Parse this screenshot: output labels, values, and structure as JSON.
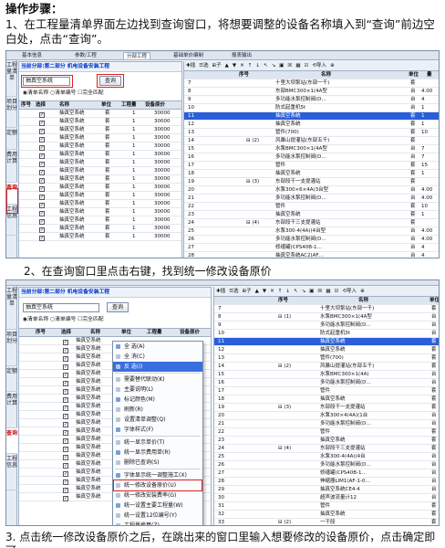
{
  "heading": "操作步骤：",
  "step1": "1、在工程量清单界面左边找到查询窗口，将想要调整的设备名称填入到“查询”前边空白处，点击“查询”。",
  "step2": "2、在查询窗口里点击右键，找到统一修改设备原价",
  "step3": "3. 点击统一修改设备原价之后，在跳出来的窗口里输入想要修改的设备原价，点击确定即可。",
  "tabs": [
    "基本信息",
    "参数/工程",
    "分部工程",
    "基础单价编制",
    "报表输出"
  ],
  "side_tabs": [
    "工程量清单",
    "项目划分",
    "定额",
    "费用计算",
    "查询",
    "工程信息"
  ],
  "side_tabs2": [
    "工程量清单",
    "项目划分",
    "定额",
    "费用计算",
    "查询",
    "工程信息"
  ],
  "panel_title": "当前分部:第二部分 机电设备安装工程",
  "search_value": "抽真空系统",
  "search_button": "查询",
  "radio_list": "◉清单名称",
  "radio_code": "○清单编号",
  "radio_full": "☐完全匹配",
  "left_cols": [
    "序号",
    "选择",
    "名称",
    "单位",
    "工程量",
    "设备原价"
  ],
  "left_cols2": [
    "序号",
    "选择",
    "名称",
    "单位",
    "工程量",
    "设备原价"
  ],
  "left_rows": [
    {
      "name": "抽真空系统",
      "unit": "套",
      "qty": "1",
      "price": "30000"
    },
    {
      "name": "抽真空系统",
      "unit": "套",
      "qty": "1",
      "price": "30000"
    },
    {
      "name": "抽真空系统",
      "unit": "套",
      "qty": "1",
      "price": "30000"
    },
    {
      "name": "抽真空系统",
      "unit": "套",
      "qty": "1",
      "price": "30000"
    },
    {
      "name": "抽真空系统",
      "unit": "套",
      "qty": "1",
      "price": "30000"
    },
    {
      "name": "抽真空系统",
      "unit": "套",
      "qty": "1",
      "price": "30000"
    },
    {
      "name": "抽真空系统",
      "unit": "套",
      "qty": "1",
      "price": "30000"
    },
    {
      "name": "抽真空系统",
      "unit": "套",
      "qty": "1",
      "price": "30000"
    },
    {
      "name": "抽真空系统",
      "unit": "套",
      "qty": "1",
      "price": "30000"
    },
    {
      "name": "抽真空系统",
      "unit": "套",
      "qty": "1",
      "price": "30000"
    },
    {
      "name": "抽真空系统",
      "unit": "套",
      "qty": "1",
      "price": "30000"
    },
    {
      "name": "抽真空系统",
      "unit": "套",
      "qty": "1",
      "price": "30000"
    },
    {
      "name": "抽真空系统",
      "unit": "套",
      "qty": "1",
      "price": "30000"
    },
    {
      "name": "抽真空系统",
      "unit": "套",
      "qty": "1",
      "price": "30000"
    },
    {
      "name": "抽真空系统",
      "unit": "套",
      "qty": "1",
      "price": "30000"
    },
    {
      "name": "抽真空系统",
      "unit": "套",
      "qty": "1",
      "price": "30000"
    }
  ],
  "left_rows2": [
    "抽真空系统",
    "抽真空系统",
    "抽真空系统",
    "抽真空系统",
    "抽真空系统",
    "抽真空系统",
    "抽真空系统",
    "抽真空系统",
    "抽真空系统",
    "抽真空系统",
    "抽真空系统",
    "抽真空系统",
    "抽真空系统",
    "抽真空系统",
    "抽真空系统",
    "抽真空系统",
    "抽真空系统",
    "抽真空系统",
    "抽真空系统",
    "抽真空系统"
  ],
  "toolbar_items": [
    "✚插",
    "☰选",
    "⊞子",
    "▲",
    "▼",
    "✕",
    "↑",
    "↓",
    "↖",
    "↘",
    "▣",
    "☒",
    "▦",
    "☑",
    "⟲导入",
    "⊕"
  ],
  "right_cols": [
    "序号",
    "名称",
    "单位",
    "量"
  ],
  "right_rows": [
    {
      "no": "7",
      "mark": "",
      "name": "十里大坝泵站(东部一千)",
      "unit": "套"
    },
    {
      "no": "8",
      "mark": "",
      "name": "东部BMC300×1(4A型",
      "unit": "台",
      "qty": "4.00"
    },
    {
      "no": "9",
      "mark": "",
      "name": "多功能水泵控制阀(D…",
      "unit": "台",
      "qty": "4"
    },
    {
      "no": "10",
      "mark": "",
      "name": "防式起重机5t",
      "unit": "台",
      "qty": "1"
    },
    {
      "no": "11",
      "mark": "",
      "name": "抽真空系统",
      "unit": "套",
      "qty": "1",
      "hl": true
    },
    {
      "no": "12",
      "mark": "",
      "name": "抽真空系统",
      "unit": "套",
      "qty": "1"
    },
    {
      "no": "13",
      "mark": "",
      "name": "管件(700)",
      "unit": "套",
      "qty": "10"
    },
    {
      "no": "14",
      "mark": "⊟ (2)",
      "name": "风暴山提灌站(东部五千)",
      "unit": "套"
    },
    {
      "no": "15",
      "mark": "",
      "name": "水泵BMC300×1(4A型",
      "unit": "台",
      "qty": "7"
    },
    {
      "no": "16",
      "mark": "",
      "name": "多功能水泵控制阀(D…",
      "unit": "台",
      "qty": "7"
    },
    {
      "no": "17",
      "mark": "",
      "name": "管件",
      "unit": "套",
      "qty": "15"
    },
    {
      "no": "18",
      "mark": "",
      "name": "抽真空系统",
      "unit": "套",
      "qty": "1"
    },
    {
      "no": "19",
      "mark": "⊟ (3)",
      "name": "东部段干一支提灌站",
      "unit": "套"
    },
    {
      "no": "20",
      "mark": "",
      "name": "水泵300×6×4A(3台型",
      "unit": "台",
      "qty": "4.00"
    },
    {
      "no": "21",
      "mark": "",
      "name": "多功能水泵控制阀(D…",
      "unit": "台",
      "qty": "4.00"
    },
    {
      "no": "22",
      "mark": "",
      "name": "管件",
      "unit": "套",
      "qty": "10"
    },
    {
      "no": "23",
      "mark": "",
      "name": "抽真空系统",
      "unit": "套",
      "qty": "1"
    },
    {
      "no": "24",
      "mark": "⊟ (4)",
      "name": "东部段干三支提灌站",
      "unit": "套"
    },
    {
      "no": "25",
      "mark": "",
      "name": "水泵300-4(4A)(4台型",
      "unit": "台",
      "qty": "4.00"
    },
    {
      "no": "26",
      "mark": "",
      "name": "多功能水泵控制阀(D…",
      "unit": "台",
      "qty": "4.00"
    },
    {
      "no": "27",
      "mark": "",
      "name": "修缮罐(CPS40B-1…",
      "unit": "台",
      "qty": "4"
    },
    {
      "no": "28",
      "mark": "",
      "name": "抽真空系统AC2(AF…",
      "unit": "台",
      "qty": "4"
    },
    {
      "no": "29",
      "mark": "",
      "name": "抽真空系统CE4-4",
      "unit": "台",
      "qty": "4"
    },
    {
      "no": "30",
      "mark": "",
      "name": "超声波流量计12",
      "unit": "台",
      "qty": "4"
    },
    {
      "no": "31",
      "mark": "",
      "name": "抽真空系统",
      "unit": "台",
      "qty": "4"
    }
  ],
  "right_rows2": [
    {
      "no": "7",
      "mark": "",
      "name": "十里大坝泵站(东部一千)",
      "unit": "套"
    },
    {
      "no": "8",
      "mark": "⊟ (1)",
      "name": "水泵BMC300×1(4A型",
      "unit": "台"
    },
    {
      "no": "9",
      "mark": "",
      "name": "多功能水泵控制阀(D…",
      "unit": "台"
    },
    {
      "no": "10",
      "mark": "",
      "name": "防式起重机5t",
      "unit": "台"
    },
    {
      "no": "11",
      "mark": "",
      "name": "抽真空系统",
      "unit": "套",
      "hl": true
    },
    {
      "no": "12",
      "mark": "",
      "name": "抽真空系统",
      "unit": "套"
    },
    {
      "no": "13",
      "mark": "",
      "name": "管件(700)",
      "unit": "套"
    },
    {
      "no": "14",
      "mark": "⊟ (2)",
      "name": "风暴山提灌站(东部五千)",
      "unit": "套"
    },
    {
      "no": "15",
      "mark": "",
      "name": "水泵BMC300×1(4A)",
      "unit": "台"
    },
    {
      "no": "16",
      "mark": "",
      "name": "多功能水泵控制阀(D…",
      "unit": "台"
    },
    {
      "no": "17",
      "mark": "",
      "name": "管件",
      "unit": "套"
    },
    {
      "no": "18",
      "mark": "",
      "name": "抽真空系统",
      "unit": "套"
    },
    {
      "no": "19",
      "mark": "⊟ (3)",
      "name": "东部段干一支提灌站",
      "unit": "套"
    },
    {
      "no": "20",
      "mark": "",
      "name": "水泵300×4(4A)(1台",
      "unit": "台"
    },
    {
      "no": "21",
      "mark": "",
      "name": "多功能水泵控制阀(D…",
      "unit": "台"
    },
    {
      "no": "22",
      "mark": "",
      "name": "管件",
      "unit": "套"
    },
    {
      "no": "23",
      "mark": "",
      "name": "抽真空系统",
      "unit": "套"
    },
    {
      "no": "24",
      "mark": "⊟ (4)",
      "name": "东部段干三支提灌站",
      "unit": "套"
    },
    {
      "no": "25",
      "mark": "",
      "name": "水泵300-4(4A)(4台",
      "unit": "台"
    },
    {
      "no": "26",
      "mark": "",
      "name": "多功能水泵控制阀(D…",
      "unit": "台"
    },
    {
      "no": "27",
      "mark": "",
      "name": "修缮罐(CPS40B-1…",
      "unit": "台"
    },
    {
      "no": "28",
      "mark": "",
      "name": "伸缩器LIM1(AF-1-0…",
      "unit": "台"
    },
    {
      "no": "29",
      "mark": "",
      "name": "抽真空系统CE4-4",
      "unit": "台"
    },
    {
      "no": "30",
      "mark": "",
      "name": "超声波流量计12",
      "unit": "台"
    },
    {
      "no": "31",
      "mark": "",
      "name": "管件",
      "unit": "套"
    },
    {
      "no": "32",
      "mark": "",
      "name": "抽真空系统",
      "unit": "套"
    },
    {
      "no": "33",
      "mark": "⊟ (2)",
      "name": "一干段",
      "unit": "套"
    }
  ],
  "context_menu": [
    {
      "label": "全  选(A)"
    },
    {
      "label": "全  消(C)"
    },
    {
      "label": "反  选(I)",
      "hl": true
    },
    {
      "sep": true
    },
    {
      "label": "需要替代联动(K)"
    },
    {
      "label": "主要说明(L)"
    },
    {
      "label": "标记颜色(M)"
    },
    {
      "label": "刷新(R)"
    },
    {
      "label": "设置清单调整(Q)"
    },
    {
      "label": "字体样式(F)"
    },
    {
      "sep": true
    },
    {
      "label": "统一显示单价(T)"
    },
    {
      "label": "统一显示费用单(R)"
    },
    {
      "label": "删除已查询(S)"
    },
    {
      "sep": true
    },
    {
      "label": "字体显示统一调整施工(X)"
    },
    {
      "label": "统一修改设备原价(U)",
      "boxed": true
    },
    {
      "label": "统一修改安装费率(G)"
    },
    {
      "label": "统一设置主要工程量(W)"
    },
    {
      "label": "统一设置12位编号(Y)"
    },
    {
      "label": "工程量换算(Z)"
    },
    {
      "label": "显示全部项(O)"
    }
  ],
  "colors": {
    "accent": "#2b5fd9",
    "red_box": "#e02020",
    "frame": "#7a8fa8"
  }
}
